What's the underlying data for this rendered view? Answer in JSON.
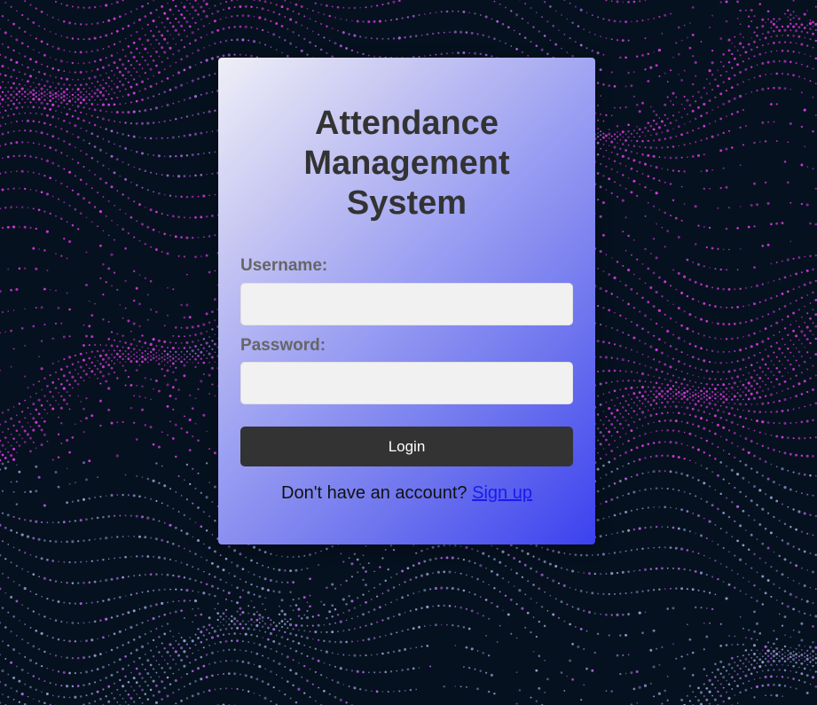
{
  "page": {
    "title": "Attendance Management System"
  },
  "form": {
    "username_label": "Username:",
    "username_value": "",
    "password_label": "Password:",
    "password_value": "",
    "login_label": "Login",
    "signup_prompt": "Don't have an account?",
    "signup_link": "Sign up"
  },
  "colors": {
    "background": "#06111f",
    "dots_magenta": "#e23ce8",
    "dots_violet": "#b868ea",
    "dots_pale": "#9aa4d8",
    "card_gradient_start": "#efeff7",
    "card_gradient_end": "#3c41ef",
    "button": "#333333",
    "link": "#1a1aee"
  }
}
